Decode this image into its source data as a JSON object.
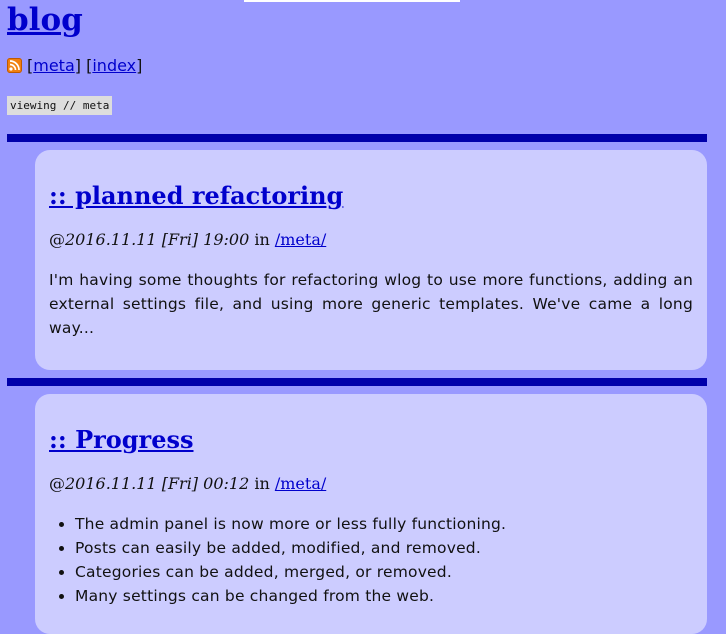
{
  "site": {
    "title": "blog"
  },
  "nav": {
    "rss_icon": "rss-feed-icon",
    "open_bracket_1": "[",
    "meta_link": "meta",
    "close_bracket_1": "]",
    "open_bracket_2": "[",
    "index_link": "index",
    "close_bracket_2": "]"
  },
  "viewing": "viewing // meta",
  "posts": [
    {
      "title": ":: planned refactoring",
      "at": "@",
      "date": "2016.11.11 [Fri] 19:00",
      "in_word": "in",
      "category": "/meta/",
      "body": "I'm having some thoughts for refactoring wlog to use more functions, adding an external settings file, and using more generic templates. We've came a long way..."
    },
    {
      "title": ":: Progress",
      "at": "@",
      "date": "2016.11.11 [Fri] 00:12",
      "in_word": "in",
      "category": "/meta/",
      "items": [
        "The admin panel is now more or less fully functioning.",
        "Posts can easily be added, modified, and removed.",
        "Categories can be added, merged, or removed.",
        "Many settings can be changed from the web."
      ]
    }
  ],
  "colors": {
    "page_background": "#9999ff",
    "post_background": "#ccccff",
    "divider": "#0000aa",
    "link": "#0000cc",
    "viewing_badge": "#dddddd"
  }
}
